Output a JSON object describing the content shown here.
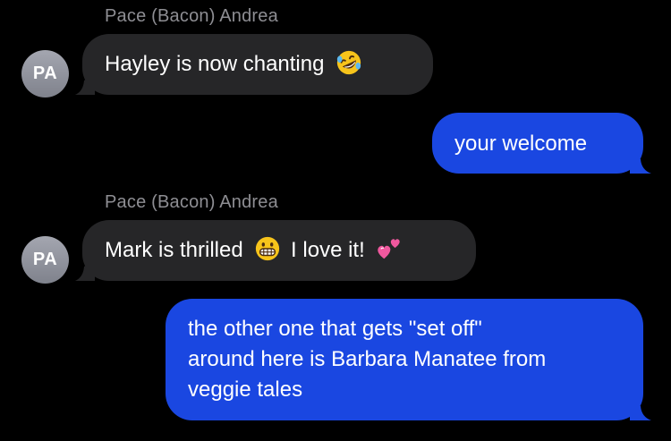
{
  "thread": {
    "messages": [
      {
        "direction": "incoming",
        "sender": "Pace (Bacon) Andrea",
        "avatar_initials": "PA",
        "text_before": "Hayley is now chanting",
        "emoji_1": "rolling-on-floor-laughing-emoji",
        "text_after": "",
        "emoji_2": ""
      },
      {
        "direction": "outgoing",
        "text": "your welcome"
      },
      {
        "direction": "incoming",
        "sender": "Pace (Bacon) Andrea",
        "avatar_initials": "PA",
        "text_before": "Mark is thrilled",
        "emoji_1": "grimacing-face-emoji",
        "text_after": "I love it!",
        "emoji_2": "two-hearts-emoji"
      },
      {
        "direction": "outgoing",
        "text_lines": [
          "the other one that gets \"set off\"",
          "around here is Barbara Manatee from",
          "veggie tales"
        ]
      }
    ]
  },
  "colors": {
    "background": "#000000",
    "incoming_bubble": "#262628",
    "outgoing_bubble": "#1a47e1",
    "sender_name": "#8e8e93",
    "text": "#ffffff"
  }
}
